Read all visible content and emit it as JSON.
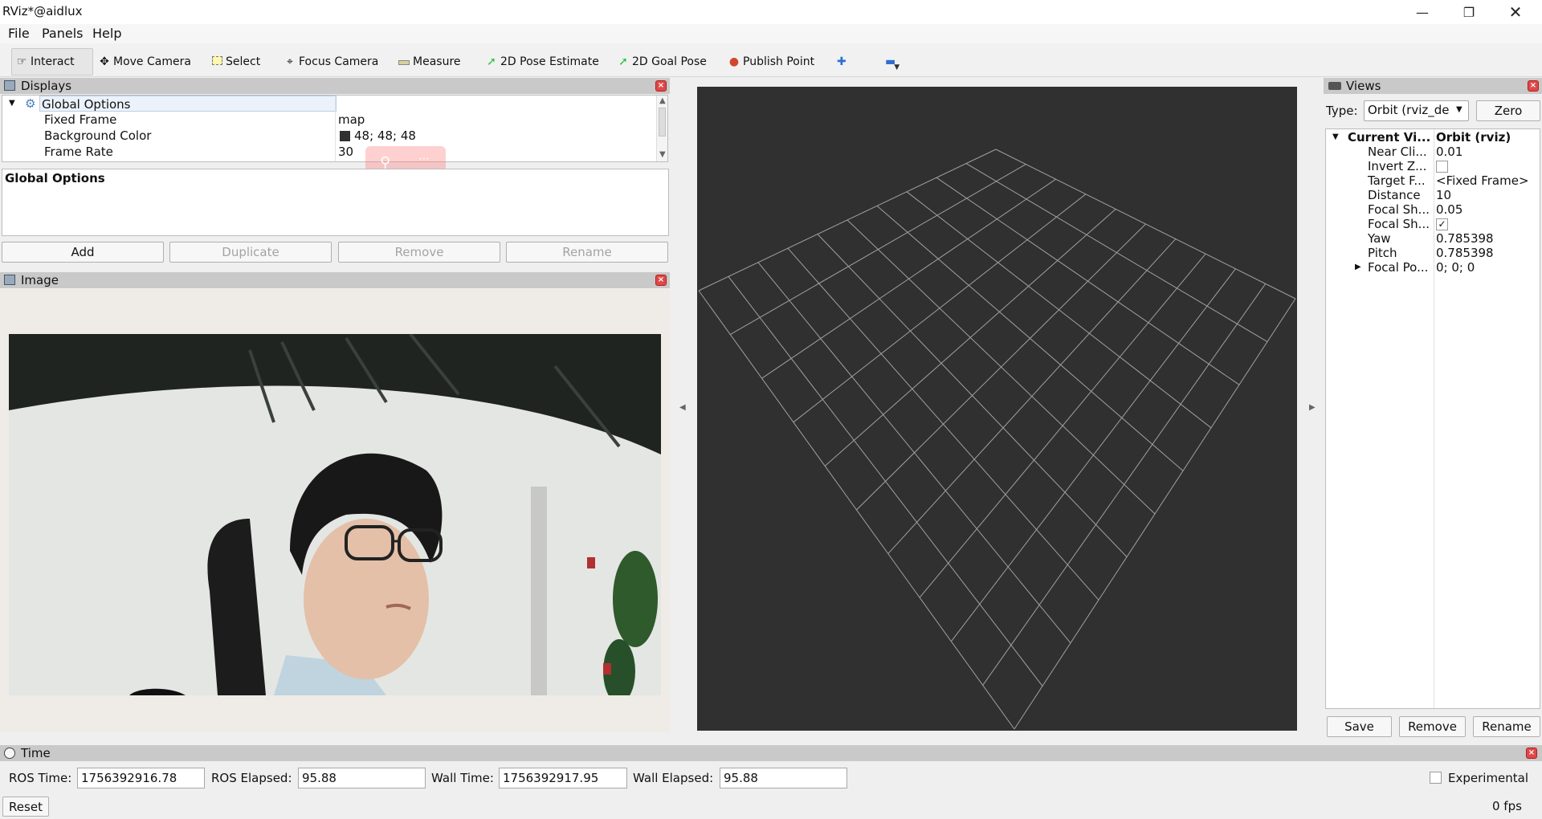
{
  "window": {
    "title": "RViz*@aidlux"
  },
  "menu": [
    "File",
    "Panels",
    "Help"
  ],
  "toolbar": {
    "interact": "Interact",
    "move_camera": "Move Camera",
    "select": "Select",
    "focus_camera": "Focus Camera",
    "measure": "Measure",
    "pose_estimate": "2D Pose Estimate",
    "goal_pose": "2D Goal Pose",
    "publish_point": "Publish Point"
  },
  "displays": {
    "title": "Displays",
    "root_label": "Global Options",
    "rows": [
      {
        "name": "Fixed Frame",
        "value": "map"
      },
      {
        "name": "Background Color",
        "value": "48; 48; 48"
      },
      {
        "name": "Frame Rate",
        "value": "30"
      }
    ],
    "description_title": "Global Options",
    "buttons": [
      "Add",
      "Duplicate",
      "Remove",
      "Rename"
    ]
  },
  "image_panel": {
    "title": "Image"
  },
  "views": {
    "title": "Views",
    "type_label": "Type:",
    "type_value": "Orbit (rviz_de",
    "zero_label": "Zero",
    "header_name": "Current Vi...",
    "header_value": "Orbit (rviz)",
    "rows": [
      {
        "name": "Near Cli...",
        "value": "0.01"
      },
      {
        "name": "Invert Z...",
        "value": ""
      },
      {
        "name": "Target F...",
        "value": "<Fixed Frame>"
      },
      {
        "name": "Distance",
        "value": "10"
      },
      {
        "name": "Focal Sh...",
        "value": "0.05"
      },
      {
        "name": "Focal Sh...",
        "value": ""
      },
      {
        "name": "Yaw",
        "value": "0.785398"
      },
      {
        "name": "Pitch",
        "value": "0.785398"
      },
      {
        "name": "Focal Po...",
        "value": "0; 0; 0"
      }
    ],
    "buttons": [
      "Save",
      "Remove",
      "Rename"
    ]
  },
  "time_panel": {
    "title": "Time",
    "ros_time_label": "ROS Time:",
    "ros_time": "1756392916.78",
    "ros_elapsed_label": "ROS Elapsed:",
    "ros_elapsed": "95.88",
    "wall_time_label": "Wall Time:",
    "wall_time": "1756392917.95",
    "wall_elapsed_label": "Wall Elapsed:",
    "wall_elapsed": "95.88",
    "experimental_label": "Experimental",
    "reset_label": "Reset",
    "fps": "0 fps"
  },
  "colors": {
    "background_swatch": "#303030",
    "viewport_bg": "#303030",
    "grid_line": "#a0a0a0"
  }
}
